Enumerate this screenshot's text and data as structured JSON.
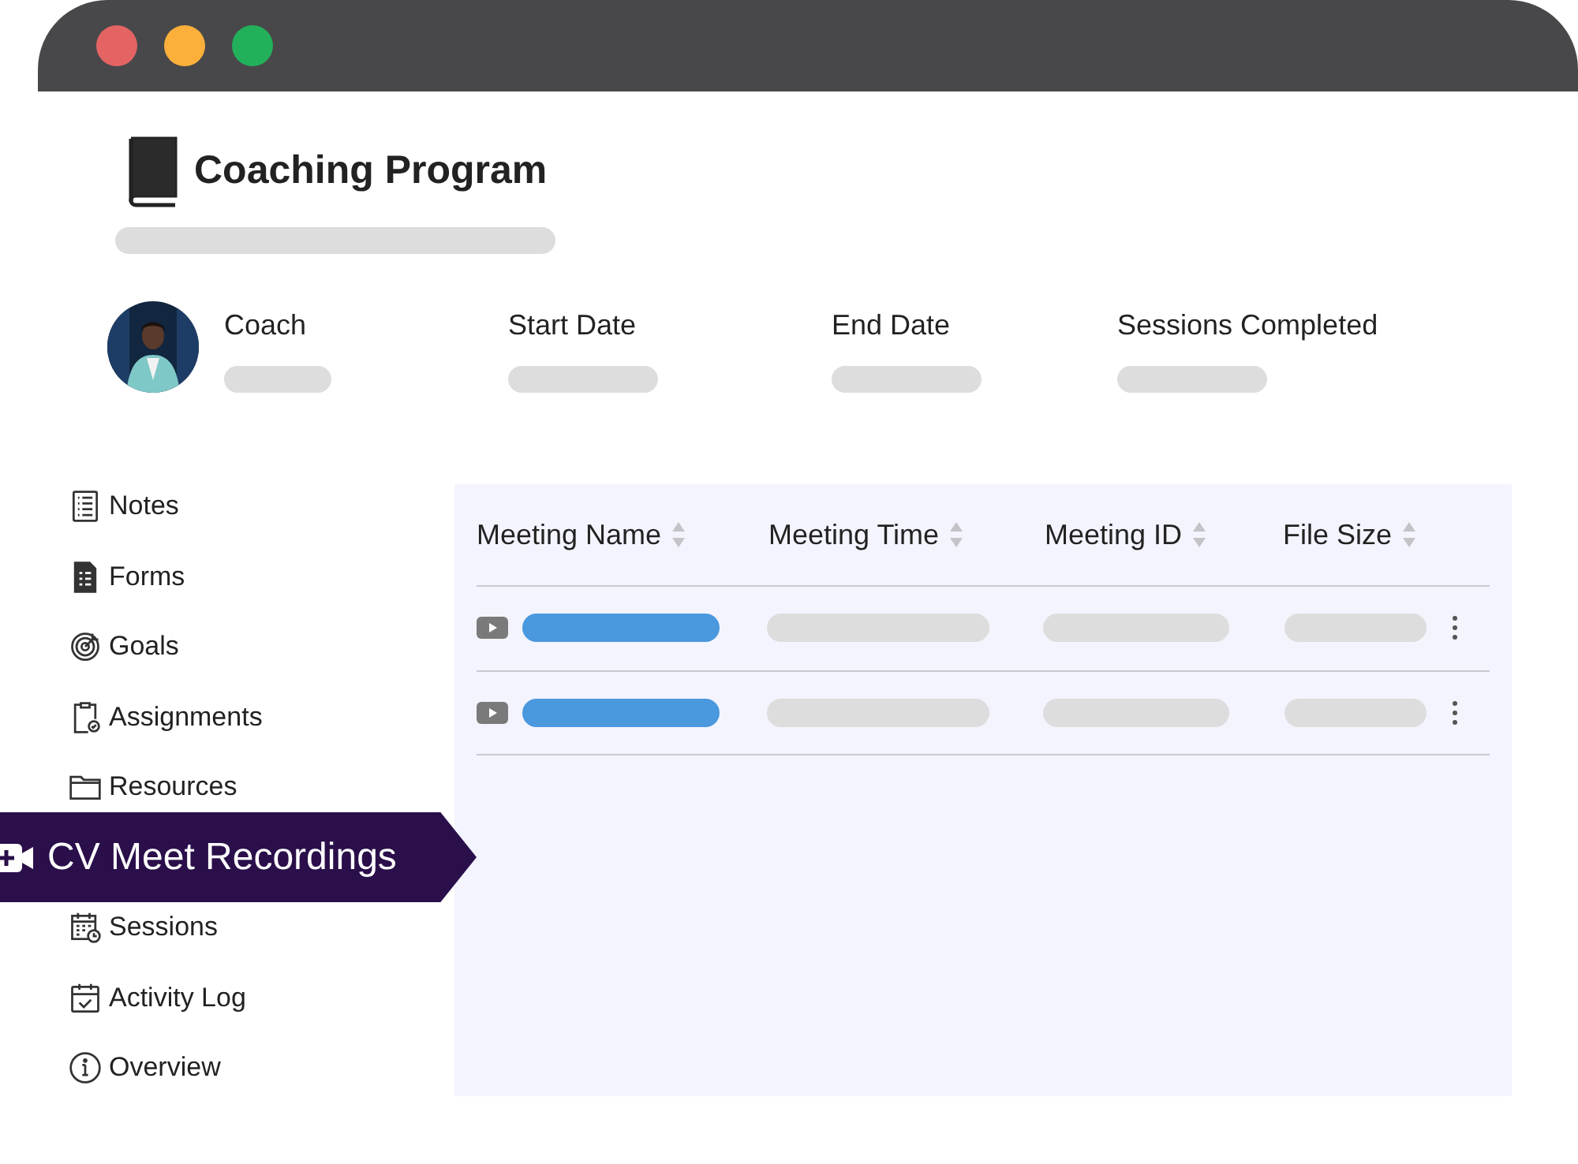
{
  "window": {
    "controls": [
      {
        "color": "#e46464"
      },
      {
        "color": "#fbb03b"
      },
      {
        "color": "#22b05a"
      }
    ]
  },
  "program": {
    "title": "Coaching Program"
  },
  "summary": [
    {
      "label": "Coach",
      "kind": "avatar"
    },
    {
      "label": "Start Date",
      "kind": "plain"
    },
    {
      "label": "End Date",
      "kind": "plain"
    },
    {
      "label": "Sessions Completed",
      "kind": "plain"
    }
  ],
  "sidebar": {
    "items": [
      {
        "label": "Notes",
        "selected": false
      },
      {
        "label": "Forms",
        "selected": false
      },
      {
        "label": "Goals",
        "selected": false
      },
      {
        "label": "Assignments",
        "selected": false
      },
      {
        "label": "Resources",
        "selected": false
      },
      {
        "label": "CV Meet Recordings",
        "selected": true
      },
      {
        "label": "Sessions",
        "selected": false
      },
      {
        "label": "Activity Log",
        "selected": false
      },
      {
        "label": "Overview",
        "selected": false
      }
    ]
  },
  "table": {
    "columns": [
      "Meeting Name",
      "Meeting Time",
      "Meeting ID",
      "File Size"
    ],
    "rows": [
      {
        "kind": "placeholder"
      },
      {
        "kind": "placeholder"
      }
    ]
  }
}
